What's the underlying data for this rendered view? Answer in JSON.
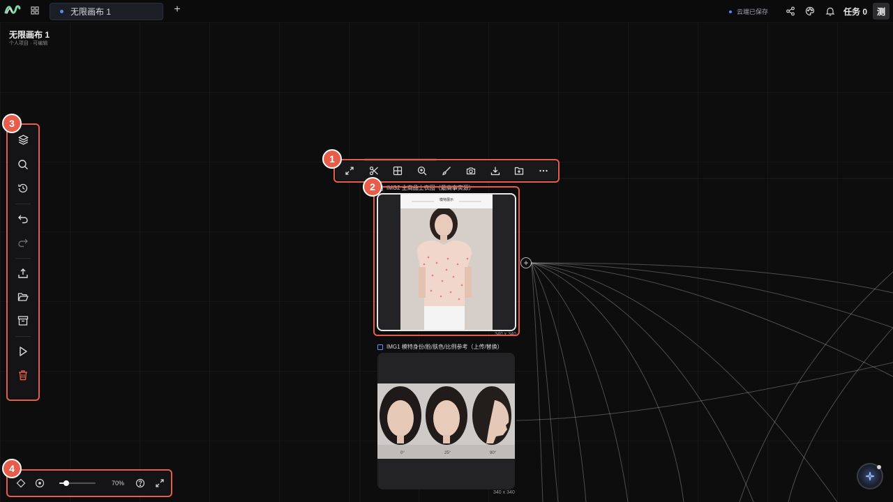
{
  "topbar": {
    "tab_label": "无限画布 1",
    "add_tab_label": "+",
    "save_status": "云端已保存",
    "tasks_label": "任务 0",
    "avatar_text": "测"
  },
  "project": {
    "title": "无限画布 1",
    "subtitle": "个人项目 · 可编辑"
  },
  "left_toolbar": {
    "items": [
      "layers-icon",
      "search-icon",
      "history-icon",
      "undo-icon",
      "redo-icon",
      "upload-icon",
      "open-folder-icon",
      "archive-icon",
      "play-icon",
      "delete-icon"
    ]
  },
  "image_toolbar": {
    "items": [
      "expand-icon",
      "scissors-icon",
      "grid-icon",
      "zoom-in-icon",
      "brush-icon",
      "camera-icon",
      "download-icon",
      "folder-add-icon",
      "more-icon"
    ]
  },
  "cards": [
    {
      "title": "IMG2 主商品上衣图（最高事实源）",
      "inner_heading": "模特展示",
      "size": "340 x 340",
      "selected": true
    },
    {
      "title": "IMG1 模特身份/脸/肤色/比例参考（上传/替换）",
      "size": "340 x 340",
      "angles": [
        "0°",
        "25°",
        "90°"
      ],
      "selected": false
    }
  ],
  "zoom": {
    "label": "70%",
    "value_percent": 70,
    "slider_fraction": 0.2
  },
  "annotations": [
    "1",
    "2",
    "3",
    "4"
  ],
  "colors": {
    "accent": "#4f8bff",
    "marker": "#e85d4a",
    "delete": "#e85d4a"
  }
}
